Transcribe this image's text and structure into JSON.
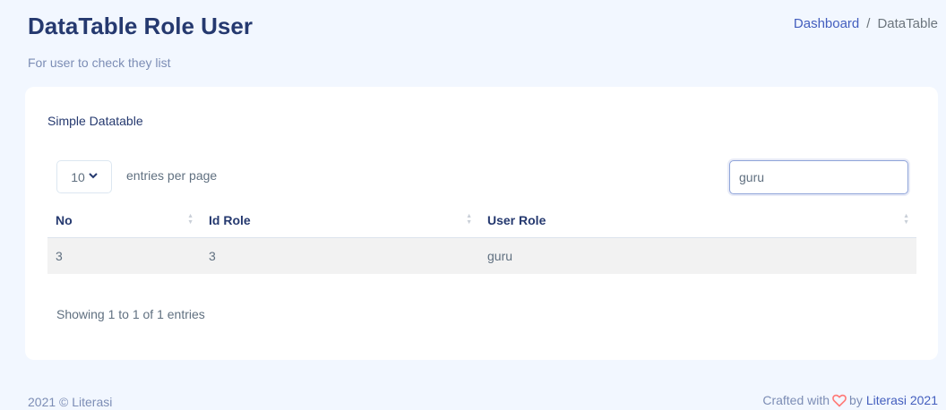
{
  "header": {
    "title": "DataTable Role User",
    "subtitle": "For user to check they list"
  },
  "breadcrumb": {
    "items": [
      "Dashboard",
      "DataTable"
    ],
    "separator": "/"
  },
  "card": {
    "title": "Simple Datatable",
    "entries_select_value": "10",
    "entries_label": "entries per page",
    "search_value": "guru",
    "columns": [
      "No",
      "Id Role",
      "User Role"
    ],
    "rows": [
      [
        "3",
        "3",
        "guru"
      ]
    ],
    "info": "Showing 1 to 1 of 1 entries"
  },
  "footer": {
    "left": "2021 © Literasi",
    "crafted_prefix": "Crafted with",
    "by": "by",
    "link": "Literasi 2021"
  },
  "icons": {
    "heart": "heart-icon",
    "select": "chevron-down-icon",
    "sort": "sort-icon"
  },
  "colors": {
    "primary": "#435ebe",
    "heart": "#ff7976",
    "background": "#f2f7ff"
  }
}
